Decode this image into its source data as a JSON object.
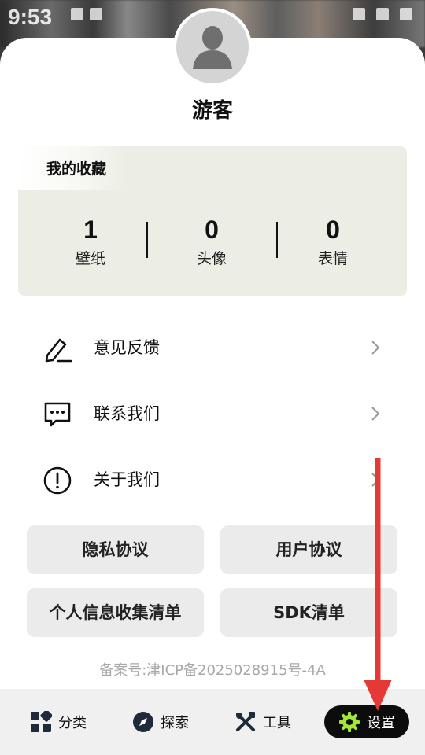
{
  "status_bar": {
    "time": "9:53"
  },
  "profile": {
    "username": "游客"
  },
  "favorites": {
    "title": "我的收藏",
    "stats": [
      {
        "value": "1",
        "label": "壁纸"
      },
      {
        "value": "0",
        "label": "头像"
      },
      {
        "value": "0",
        "label": "表情"
      }
    ]
  },
  "menu": [
    {
      "label": "意见反馈",
      "icon": "edit-pencil-icon"
    },
    {
      "label": "联系我们",
      "icon": "message-dots-icon"
    },
    {
      "label": "关于我们",
      "icon": "info-exclamation-icon"
    }
  ],
  "buttons": {
    "privacy": "隐私协议",
    "user_agreement": "用户协议",
    "info_list": "个人信息收集清单",
    "sdk_list": "SDK清单"
  },
  "icp": "备案号:津ICP备2025028915号-4A",
  "bottom_nav": [
    {
      "label": "分类",
      "icon": "grid-icon"
    },
    {
      "label": "探索",
      "icon": "compass-icon"
    },
    {
      "label": "工具",
      "icon": "tools-icon"
    },
    {
      "label": "设置",
      "icon": "gear-icon",
      "active": true
    }
  ],
  "colors": {
    "active_icon": "#a3e635",
    "annotation_arrow": "#e53935",
    "card_bg": "#ecede4"
  }
}
